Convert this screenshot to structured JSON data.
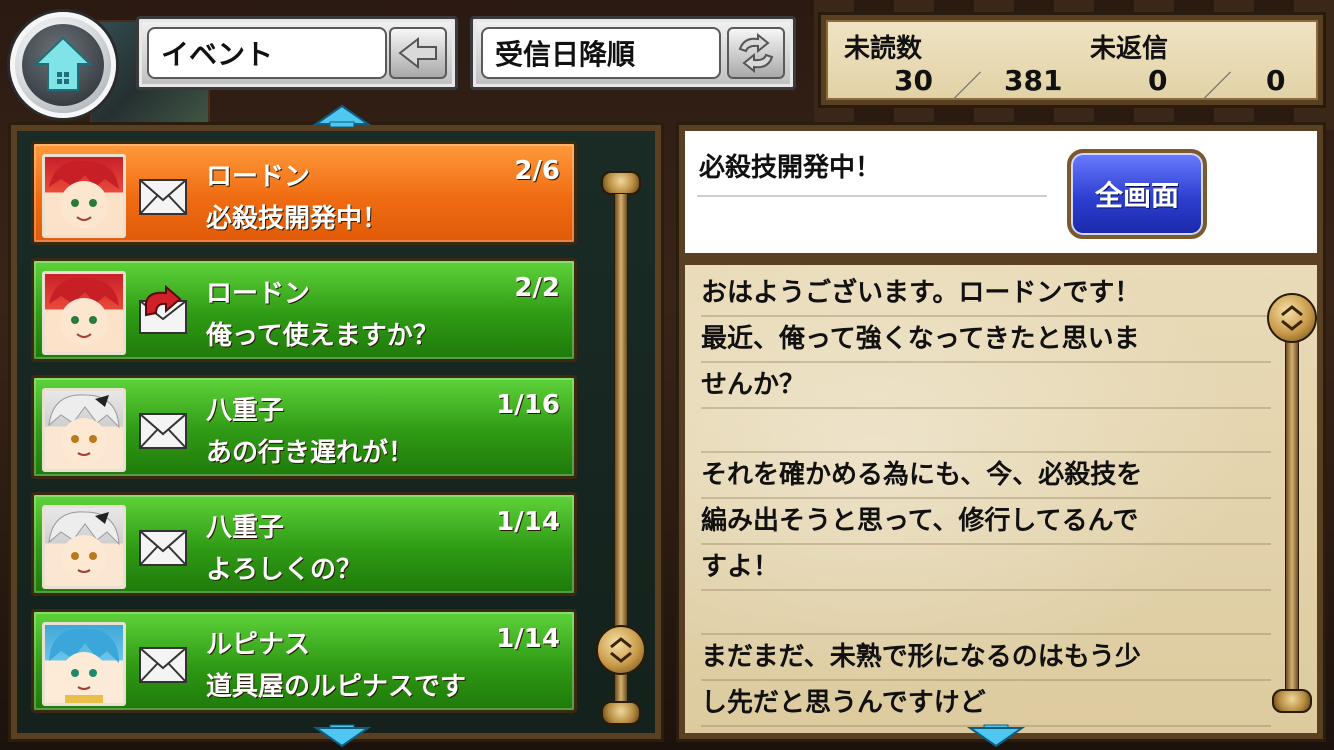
{
  "header": {
    "category_select": "イベント",
    "sort_select": "受信日降順"
  },
  "counters": {
    "unread_label": "未読数",
    "unreplied_label": "未返信",
    "unread": "30",
    "total": "381",
    "unreplied": "0",
    "unreplied_total": "0",
    "separator": "／"
  },
  "messages": [
    {
      "sender": "ロードン",
      "count": "2/6",
      "subject": "必殺技開発中！",
      "selected": true,
      "icon": "mail-icon"
    },
    {
      "sender": "ロードン",
      "count": "2/2",
      "subject": "俺って使えますか？",
      "selected": false,
      "icon": "reply-mail-icon"
    },
    {
      "sender": "八重子",
      "count": "1/16",
      "subject": "あの行き遅れが！",
      "selected": false,
      "icon": "mail-icon"
    },
    {
      "sender": "八重子",
      "count": "1/14",
      "subject": "よろしくの？",
      "selected": false,
      "icon": "mail-icon"
    },
    {
      "sender": "ルピナス",
      "count": "1/14",
      "subject": "道具屋のルピナスです",
      "selected": false,
      "icon": "mail-icon"
    }
  ],
  "detail": {
    "title": "必殺技開発中！",
    "fullscreen_label": "全画面",
    "lines": [
      "おはようございます。ロードンです！",
      "最近、俺って強くなってきたと思いま",
      "せんか？",
      "",
      "それを確かめる為にも、今、必殺技を",
      "編み出そうと思って、修行してるんで",
      "すよ！",
      "",
      "まだまだ、未熟で形になるのはもう少",
      "し先だと思うんですけど"
    ]
  },
  "colors": {
    "selected_item": "#f06c12",
    "item": "#2f9a15",
    "fullscreen_button": "#2d3fd0",
    "parchment": "#e2d2a6"
  }
}
